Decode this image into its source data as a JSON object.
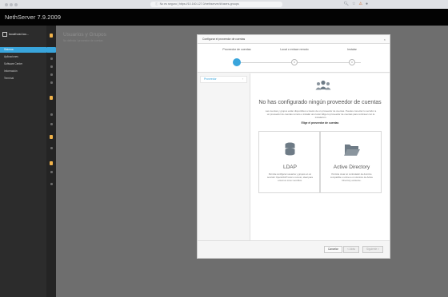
{
  "browser": {
    "url": "No es seguro | https://10.160.127.0/nethserver/#/users-groups",
    "lock_label": "ⓘ"
  },
  "app": {
    "title": "NethServer 7.9.2009"
  },
  "sidebar": {
    "server": "localhost.loc...",
    "items": [
      {
        "label": "Sistema",
        "active": true
      },
      {
        "label": "Aplicaciones"
      },
      {
        "label": "Software Center"
      },
      {
        "label": "Información"
      },
      {
        "label": "Terminal"
      }
    ]
  },
  "page": {
    "title": "Usuarios y Grupos",
    "subtitle": "No definido / proveedor de cuentas"
  },
  "dialog": {
    "title": "Configurar el proveedor de cuentas",
    "steps": [
      {
        "label": "Proveedor de cuentas",
        "active": true
      },
      {
        "label": "Local o enlace remoto"
      },
      {
        "label": "Instalar"
      }
    ],
    "subnav": {
      "label": "Proveedor",
      "chevron": "›"
    },
    "heading": "No has configurado ningún proveedor de cuentas",
    "description": "Las cuentas y grupos están disponibles a través de un proveedor de cuentas. Puedes conectar tu servidor a un proveedor de cuentas remoto o instalar uno local. Elige tu proveedor de cuentas para continuar con la instalación.",
    "choose": "Elige el proveedor de cuentas",
    "cards": [
      {
        "name": "LDAP",
        "desc": "Permite configurar usuarios y grupos en un servidor OpenLDAP local o remoto, ideal para entornos Linux sencillos."
      },
      {
        "name": "Active Directory",
        "desc": "Permite crear un controlador de dominio compatible o unirse a un dominio de Active Directory existente."
      }
    ],
    "buttons": {
      "cancel": "Cancelar",
      "back": "< Atrás",
      "next": "Siguiente >"
    }
  },
  "colors": {
    "accent": "#39a5dc",
    "warning": "#f0b24a",
    "topbar": "#030303"
  }
}
